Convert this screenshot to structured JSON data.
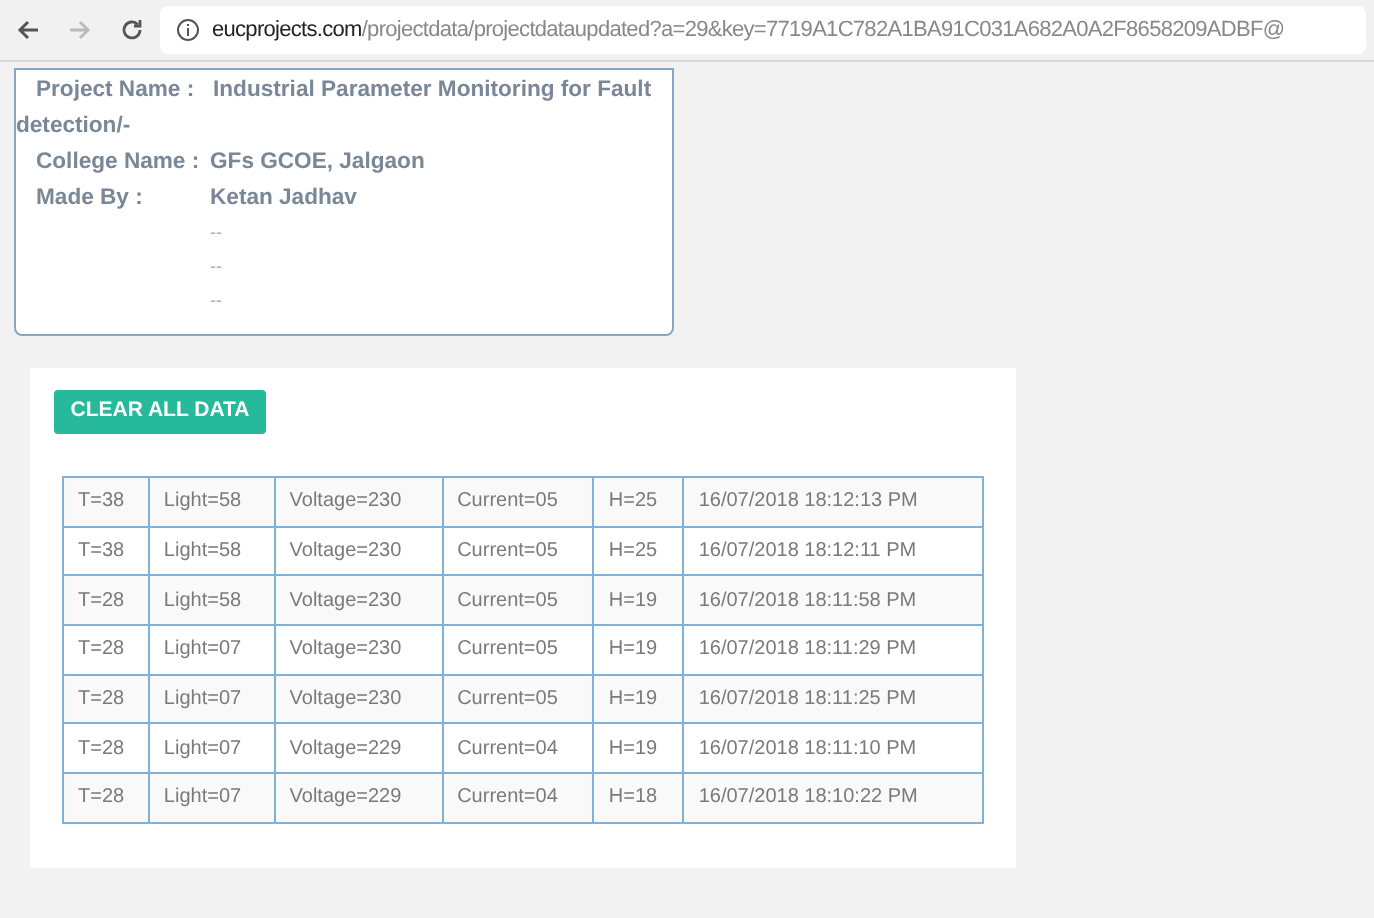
{
  "browser": {
    "url_host": "eucprojects.com",
    "url_path": "/projectdata/projectdataupdated?a=29&key=7719A1C782A1BA91C031A682A0A2F8658209ADBF@"
  },
  "project": {
    "name_label": "Project Name :",
    "name_value": "Industrial Parameter Monitoring for Fault detection/-",
    "college_label": "College Name :",
    "college_value": "GFs GCOE, Jalgaon",
    "made_by_label": "Made By :",
    "members": [
      "Ketan Jadhav",
      "--",
      "--",
      "--"
    ]
  },
  "button": "CLEAR ALL DATA",
  "table": {
    "rows": [
      [
        "T=38",
        "Light=58",
        "Voltage=230",
        "Current=05",
        "H=25",
        "16/07/2018 18:12:13 PM"
      ],
      [
        "T=38",
        "Light=58",
        "Voltage=230",
        "Current=05",
        "H=25",
        "16/07/2018 18:12:11 PM"
      ],
      [
        "T=28",
        "Light=58",
        "Voltage=230",
        "Current=05",
        "H=19",
        "16/07/2018 18:11:58 PM"
      ],
      [
        "T=28",
        "Light=07",
        "Voltage=230",
        "Current=05",
        "H=19",
        "16/07/2018 18:11:29 PM"
      ],
      [
        "T=28",
        "Light=07",
        "Voltage=230",
        "Current=05",
        "H=19",
        "16/07/2018 18:11:25 PM"
      ],
      [
        "T=28",
        "Light=07",
        "Voltage=229",
        "Current=04",
        "H=19",
        "16/07/2018 18:11:10 PM"
      ],
      [
        "T=28",
        "Light=07",
        "Voltage=229",
        "Current=04",
        "H=18",
        "16/07/2018 18:10:22 PM"
      ]
    ]
  }
}
